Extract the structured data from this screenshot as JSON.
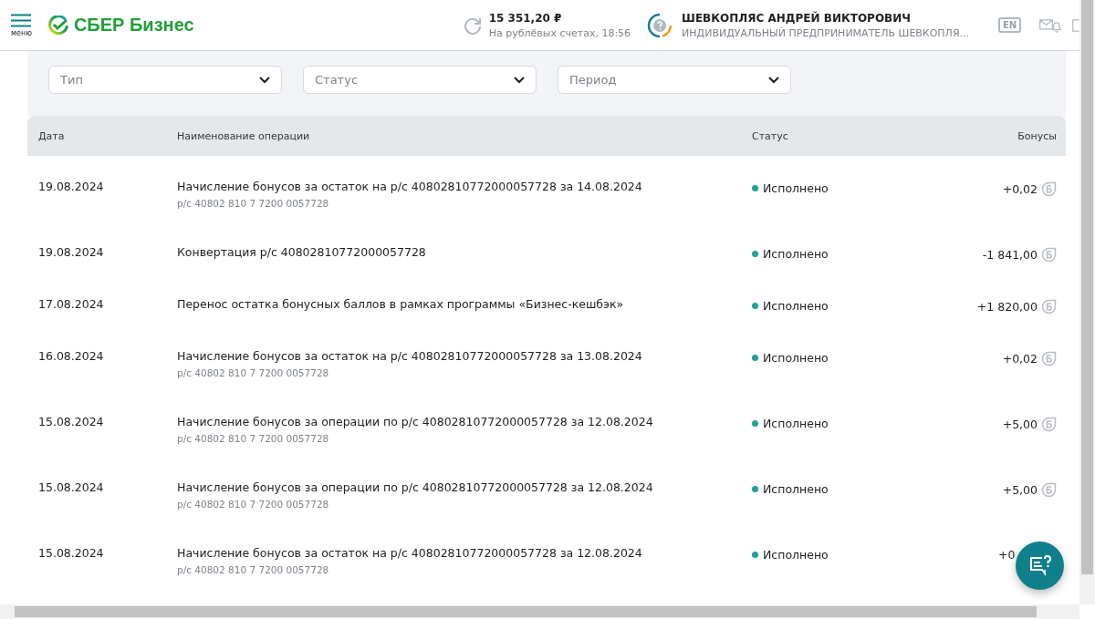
{
  "header": {
    "menu_label": "меню",
    "logo_text": "СБЕР Бизнес",
    "balance": "15 351,20 ₽",
    "balance_note": "На рублёвых счетах, 18:56",
    "user_name": "ШЕВКОПЛЯС АНДРЕЙ ВИКТОРОВИЧ",
    "user_org": "ИНДИВИДУАЛЬНЫЙ ПРЕДПРИНИМАТЕЛЬ ШЕВКОПЛЯ...",
    "lang": "EN"
  },
  "filters": [
    {
      "placeholder": "Тип"
    },
    {
      "placeholder": "Статус"
    },
    {
      "placeholder": "Период"
    }
  ],
  "table": {
    "columns": [
      "Дата",
      "Наименование операции",
      "Статус",
      "Бонусы"
    ],
    "rows": [
      {
        "date": "19.08.2024",
        "name": "Начисление бонусов за остаток на р/с 40802810772000057728 за 14.08.2024",
        "account": "р/с 40802 810 7 7200 0057728",
        "status": "Исполнено",
        "color": "#21a19a",
        "bonus": "+0,02",
        "covered": false
      },
      {
        "date": "19.08.2024",
        "name": "Конвертация р/с 40802810772000057728",
        "status": "Исполнено",
        "color": "#21a19a",
        "bonus": "-1 841,00",
        "covered": false
      },
      {
        "date": "17.08.2024",
        "name": "Перенос остатка бонусных баллов в рамках программы «Бизнес-кешбэк»",
        "status": "Исполнено",
        "color": "#21a19a",
        "bonus": "+1 820,00",
        "covered": false
      },
      {
        "date": "16.08.2024",
        "name": "Начисление бонусов за остаток на р/с 40802810772000057728 за 13.08.2024",
        "account": "р/с 40802 810 7 7200 0057728",
        "status": "Исполнено",
        "color": "#21a19a",
        "bonus": "+0,02",
        "covered": false
      },
      {
        "date": "15.08.2024",
        "name": "Начисление бонусов за операции по р/с 40802810772000057728 за 12.08.2024",
        "account": "р/с 40802 810 7 7200 0057728",
        "status": "Исполнено",
        "color": "#21a19a",
        "bonus": "+5,00",
        "covered": false
      },
      {
        "date": "15.08.2024",
        "name": "Начисление бонусов за операции по р/с 40802810772000057728 за 12.08.2024",
        "account": "р/с 40802 810 7 7200 0057728",
        "status": "Исполнено",
        "color": "#21a19a",
        "bonus": "+5,00",
        "covered": false
      },
      {
        "date": "15.08.2024",
        "name": "Начисление бонусов за остаток на р/с 40802810772000057728 за 12.08.2024",
        "account": "р/с 40802 810 7 7200 0057728",
        "status": "Исполнено",
        "color": "#21a19a",
        "bonus": "+0",
        "covered": true
      }
    ]
  }
}
